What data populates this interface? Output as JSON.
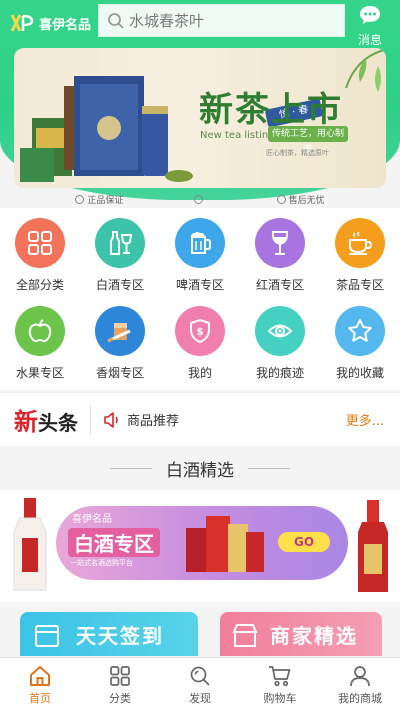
{
  "header": {
    "logo_text": "喜伊名品",
    "search_placeholder": "水城春茶叶",
    "message_label": "消息"
  },
  "banner": {
    "title": "新茶上市",
    "subtitle_en": "New tea listing",
    "flag": "惊 · 春",
    "tag": "传统工艺，用心制茶",
    "desc": "匠心制茶，精选原叶"
  },
  "guarantees": [
    "正品保证",
    "",
    "售后无忧"
  ],
  "categories": [
    {
      "label": "全部分类",
      "icon": "grid-icon",
      "color": "#f2735a"
    },
    {
      "label": "白酒专区",
      "icon": "liquor-icon",
      "color": "#3cc3a9"
    },
    {
      "label": "啤酒专区",
      "icon": "beer-icon",
      "color": "#3ea6ea"
    },
    {
      "label": "红酒专区",
      "icon": "wine-glass-icon",
      "color": "#a774e0"
    },
    {
      "label": "茶品专区",
      "icon": "tea-cup-icon",
      "color": "#f59d1c"
    },
    {
      "label": "水果专区",
      "icon": "apple-icon",
      "color": "#6cc44a"
    },
    {
      "label": "香烟专区",
      "icon": "cigarette-icon",
      "color": "#2d86d8"
    },
    {
      "label": "我的",
      "icon": "coupon-icon",
      "color": "#f07fb0"
    },
    {
      "label": "我的痕迹",
      "icon": "footprint-icon",
      "color": "#45d1c1"
    },
    {
      "label": "我的收藏",
      "icon": "star-icon",
      "color": "#54b8ef"
    }
  ],
  "news": {
    "logo_red": "新",
    "logo_rest": "头条",
    "text": "商品推荐",
    "more": "更多..."
  },
  "section": {
    "title": "白酒精选"
  },
  "liquor_banner": {
    "brand": "喜伊名品",
    "title": "白酒专区",
    "subtitle": "一站式名酒选购平台",
    "go": "GO"
  },
  "promos": {
    "left": "天天签到",
    "right": "商家精选"
  },
  "tabbar": [
    {
      "label": "首页",
      "icon": "home-icon",
      "active": true
    },
    {
      "label": "分类",
      "icon": "category-icon",
      "active": false
    },
    {
      "label": "发现",
      "icon": "discover-icon",
      "active": false
    },
    {
      "label": "购物车",
      "icon": "cart-icon",
      "active": false
    },
    {
      "label": "我的商城",
      "icon": "user-icon",
      "active": false
    }
  ],
  "colors": {
    "header_green": "#34d58a",
    "accent_orange": "#e2741a",
    "news_red": "#d8262c"
  }
}
